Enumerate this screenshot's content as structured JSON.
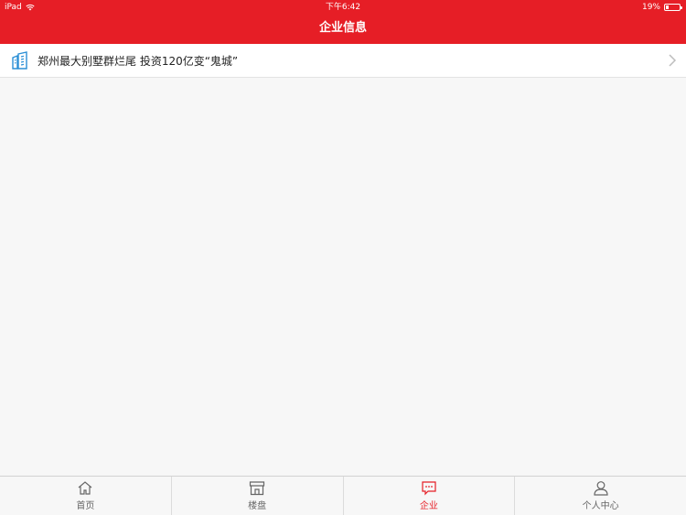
{
  "status_bar": {
    "device": "iPad",
    "time": "下午6:42",
    "battery_percent": "19%",
    "battery_level": 0.19
  },
  "header": {
    "title": "企业信息",
    "color": "#e61e26"
  },
  "list": {
    "items": [
      {
        "icon": "building-icon",
        "text": "郑州最大别墅群烂尾 投资120亿变“鬼城”"
      }
    ]
  },
  "tabbar": {
    "tabs": [
      {
        "icon": "home-icon",
        "label": "首页",
        "active": false
      },
      {
        "icon": "store-icon",
        "label": "楼盘",
        "active": false
      },
      {
        "icon": "message-icon",
        "label": "企业",
        "active": true
      },
      {
        "icon": "person-icon",
        "label": "个人中心",
        "active": false
      }
    ]
  }
}
